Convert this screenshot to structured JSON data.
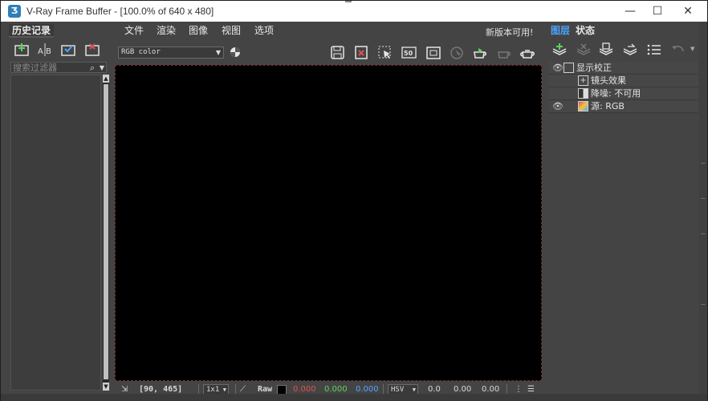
{
  "window": {
    "title": "V-Ray Frame Buffer - [100.0% of 640 x 480]",
    "app_icon_glyph": "Ʒ",
    "controls": {
      "minimize": "—",
      "maximize": "☐",
      "close": "✕"
    }
  },
  "history": {
    "tab_label": "历史记录",
    "icons": [
      "save-to-history-icon",
      "ab-compare-icon",
      "load-history-icon",
      "remove-history-icon"
    ],
    "filter_placeholder": "搜索过滤器"
  },
  "menu": {
    "items": [
      "文件",
      "渲染",
      "图像",
      "视图",
      "选项"
    ],
    "update_notice": "新版本可用!"
  },
  "toolbar": {
    "channel": "RGB color",
    "icons": [
      "save-image-icon",
      "clear-image-icon",
      "region-render-icon",
      "pixel-50-icon",
      "track-mouse-icon",
      "render-last-icon",
      "start-interactive-icon",
      "stop-render-icon",
      "render-teapot-icon"
    ]
  },
  "status": {
    "coords": "[90, 465]",
    "zoom": "1x1",
    "raw_label": "Raw",
    "r": "0.000",
    "g": "0.000",
    "b": "0.000",
    "color_mode": "HSV",
    "h": "0.0",
    "s": "0.00",
    "v": "0.00",
    "colors": {
      "r": "#e05050",
      "g": "#5fd35f",
      "b": "#55a4ff"
    }
  },
  "layers": {
    "tabs": [
      "图层",
      "状态"
    ],
    "active_tab_color": "#4aa3ff",
    "rows": [
      {
        "label": "显示校正",
        "visible": true
      },
      {
        "label": "镜头效果",
        "visible": false
      },
      {
        "label": "降噪: 不可用",
        "visible": false
      },
      {
        "label": "源: RGB",
        "visible": true
      }
    ]
  }
}
